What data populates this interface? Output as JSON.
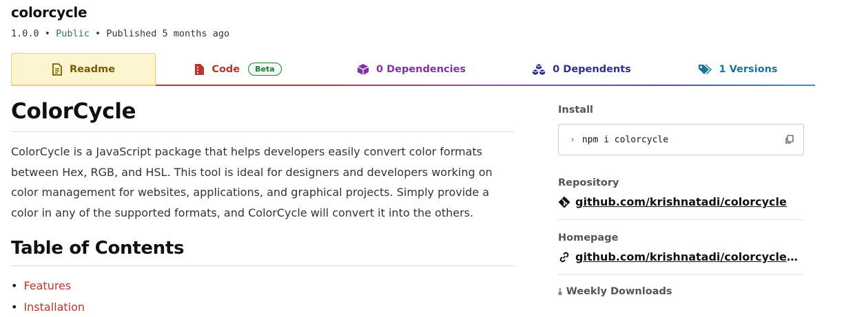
{
  "package": {
    "name": "colorcycle",
    "version": "1.0.0",
    "sep1": "•",
    "visibility": "Public",
    "sep2": "•",
    "published": "Published 5 months ago"
  },
  "tabs": [
    {
      "label": "Readme",
      "icon": "readme-icon"
    },
    {
      "label": "Code",
      "icon": "code-file-icon",
      "badge": "Beta"
    },
    {
      "label": "0 Dependencies",
      "icon": "package-box-icon"
    },
    {
      "label": "0 Dependents",
      "icon": "package-stack-icon"
    },
    {
      "label": "1 Versions",
      "icon": "tags-icon"
    }
  ],
  "readme": {
    "title": "ColorCycle",
    "intro": "ColorCycle is a JavaScript package that helps developers easily convert color formats between Hex, RGB, and HSL. This tool is ideal for designers and developers working on color management for websites, applications, and graphical projects. Simply provide a color in any of the supported formats, and ColorCycle will convert it into the others.",
    "toc_title": "Table of Contents",
    "toc": [
      "Features",
      "Installation"
    ]
  },
  "sidebar": {
    "install_label": "Install",
    "install_prompt": "›",
    "install_command": "npm i colorcycle",
    "repository_label": "Repository",
    "repository_link": "github.com/krishnatadi/colorcycle",
    "homepage_label": "Homepage",
    "homepage_link": "github.com/krishnatadi/colorcycle#rea…",
    "downloads_label": "Weekly Downloads"
  },
  "colors": {
    "readme_tab": "#7a5b00",
    "code_tab": "#b6352d",
    "deps_tab": "#8332a5",
    "dependents_tab": "#2f2e92",
    "versions_tab": "#19749d",
    "public": "#2b7a47"
  }
}
